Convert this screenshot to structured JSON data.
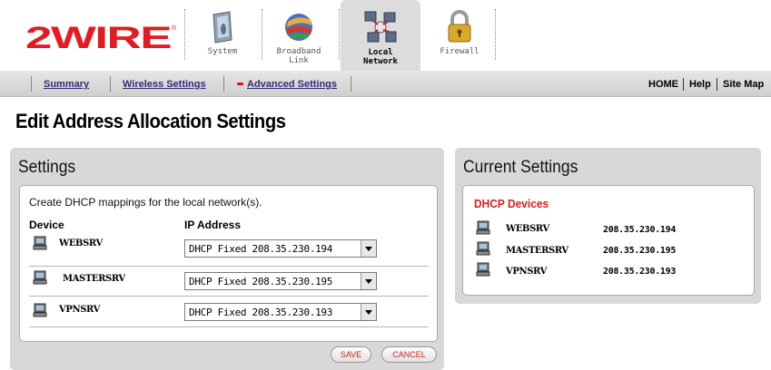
{
  "header": {
    "logo_text": "2WIRE",
    "tabs": [
      {
        "label": "System",
        "icon": "system-icon",
        "active": false
      },
      {
        "label": "Broadband\nLink",
        "icon": "broadband-globe-icon",
        "active": false
      },
      {
        "label": "Local\nNetwork",
        "icon": "local-network-icon",
        "active": true
      },
      {
        "label": "Firewall",
        "icon": "padlock-icon",
        "active": false
      }
    ]
  },
  "nav": {
    "summary": "Summary",
    "wireless": "Wireless Settings",
    "advanced": "Advanced Settings",
    "home": "HOME",
    "help": "Help",
    "sitemap": "Site Map"
  },
  "page": {
    "title": "Edit Address Allocation Settings"
  },
  "settings": {
    "title": "Settings",
    "description": "Create DHCP mappings for the local network(s).",
    "col_device": "Device",
    "col_ip": "IP Address",
    "rows": [
      {
        "device": "WEBSRV",
        "ip": "DHCP Fixed 208.35.230.194"
      },
      {
        "device": "MASTERSRV",
        "ip": "DHCP Fixed 208.35.230.195"
      },
      {
        "device": "VPNSRV",
        "ip": "DHCP Fixed 208.35.230.193"
      }
    ],
    "save_label": "SAVE",
    "cancel_label": "CANCEL"
  },
  "current": {
    "title": "Current Settings",
    "section_title": "DHCP Devices",
    "devices": [
      {
        "name": "WEBSRV",
        "ip": "208.35.230.194"
      },
      {
        "name": "MASTERSRV",
        "ip": "208.35.230.195"
      },
      {
        "name": "VPNSRV",
        "ip": "208.35.230.193"
      }
    ]
  },
  "colors": {
    "accent_red": "#d81e1e",
    "link_purple": "#3a2a7a",
    "panel_gray": "#d8d8d8"
  }
}
